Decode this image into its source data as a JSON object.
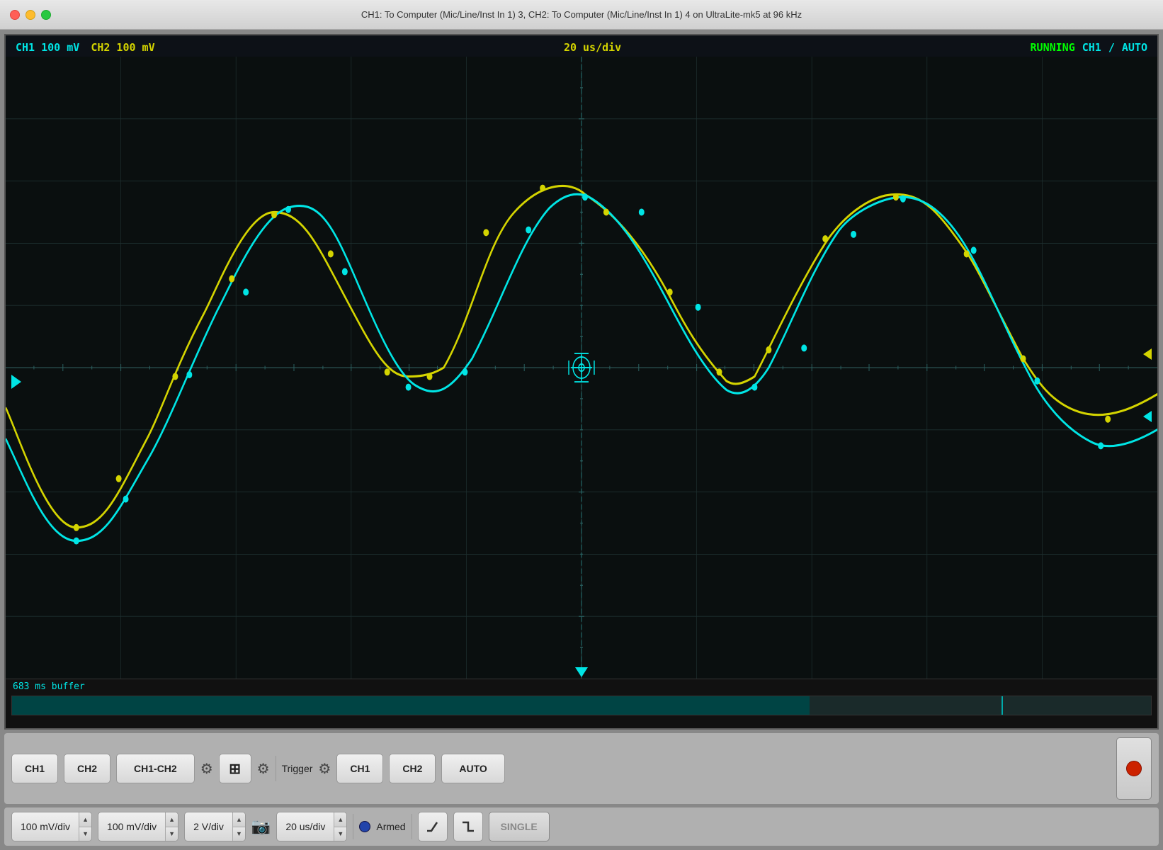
{
  "titleBar": {
    "title": "CH1: To Computer (Mic/Line/Inst In 1) 3, CH2: To Computer (Mic/Line/Inst In 1) 4 on UltraLite-mk5 at 96 kHz"
  },
  "scopeHeader": {
    "ch1Label": "CH1 100 mV",
    "ch2Label": "CH2 100 mV",
    "timeDiv": "20 us/div",
    "status": "RUNNING",
    "triggerCh": "CH1",
    "triggerSlash": "/",
    "triggerMode": "AUTO"
  },
  "bufferArea": {
    "label": "683 ms buffer"
  },
  "controls1": {
    "ch1Btn": "CH1",
    "ch2Btn": "CH2",
    "ch1ch2Btn": "CH1-CH2",
    "triggerLabel": "Trigger",
    "trigCh1Btn": "CH1",
    "trigCh2Btn": "CH2",
    "autoBtn": "AUTO"
  },
  "controls2": {
    "ch1Div": "100 mV/div",
    "ch2Div": "100 mV/div",
    "timeDiv2": "2 V/div",
    "timePerDiv": "20 us/div",
    "armedLabel": "Armed",
    "singleBtn": "SINGLE"
  },
  "waveform": {
    "ch1Color": "#00e5e5",
    "ch2Color": "#d4d400",
    "gridColor": "#1e2e2e",
    "bgColor": "#0a0f0f"
  }
}
